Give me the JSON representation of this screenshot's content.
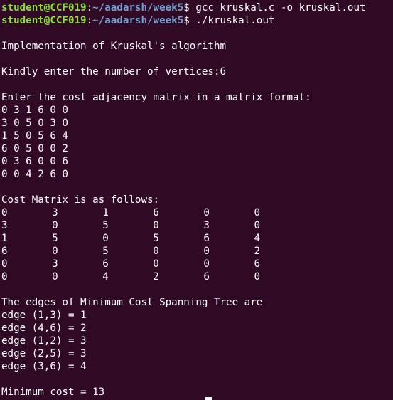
{
  "terminal": {
    "bg_color": "#300a24",
    "fg_color": "#ffffff",
    "prompt_user_color": "#8ae234",
    "prompt_path_color": "#729fcf",
    "prompts": [
      {
        "user": "student@CCF019",
        "sep": ":",
        "path": "~/aadarsh/week5",
        "symbol": "$ ",
        "command": "gcc kruskal.c -o kruskal.out"
      },
      {
        "user": "student@CCF019",
        "sep": ":",
        "path": "~/aadarsh/week5",
        "symbol": "$ ",
        "command": "./kruskal.out"
      }
    ],
    "title_line": "Implementation of Kruskal's algorithm",
    "vertices_prompt": "Kindly enter the number of vertices:6",
    "matrix_prompt": "Enter the cost adjacency matrix in a matrix format:",
    "input_rows": [
      "0 3 1 6 0 0",
      "3 0 5 0 3 0",
      "1 5 0 5 6 4",
      "6 0 5 0 0 2",
      "0 3 6 0 0 6",
      "0 0 4 2 6 0"
    ],
    "cost_header": "Cost Matrix is as follows:",
    "cost_rows": [
      [
        "0",
        "3",
        "1",
        "6",
        "0",
        "0"
      ],
      [
        "3",
        "0",
        "5",
        "0",
        "3",
        "0"
      ],
      [
        "1",
        "5",
        "0",
        "5",
        "6",
        "4"
      ],
      [
        "6",
        "0",
        "5",
        "0",
        "0",
        "2"
      ],
      [
        "0",
        "3",
        "6",
        "0",
        "0",
        "6"
      ],
      [
        "0",
        "0",
        "4",
        "2",
        "6",
        "0"
      ]
    ],
    "mst_header": "The edges of Minimum Cost Spanning Tree are",
    "edges": [
      "edge (1,3) = 1",
      "edge (4,6) = 2",
      "edge (1,2) = 3",
      "edge (2,5) = 3",
      "edge (3,6) = 4"
    ],
    "min_cost_line": "Minimum cost = 13"
  }
}
